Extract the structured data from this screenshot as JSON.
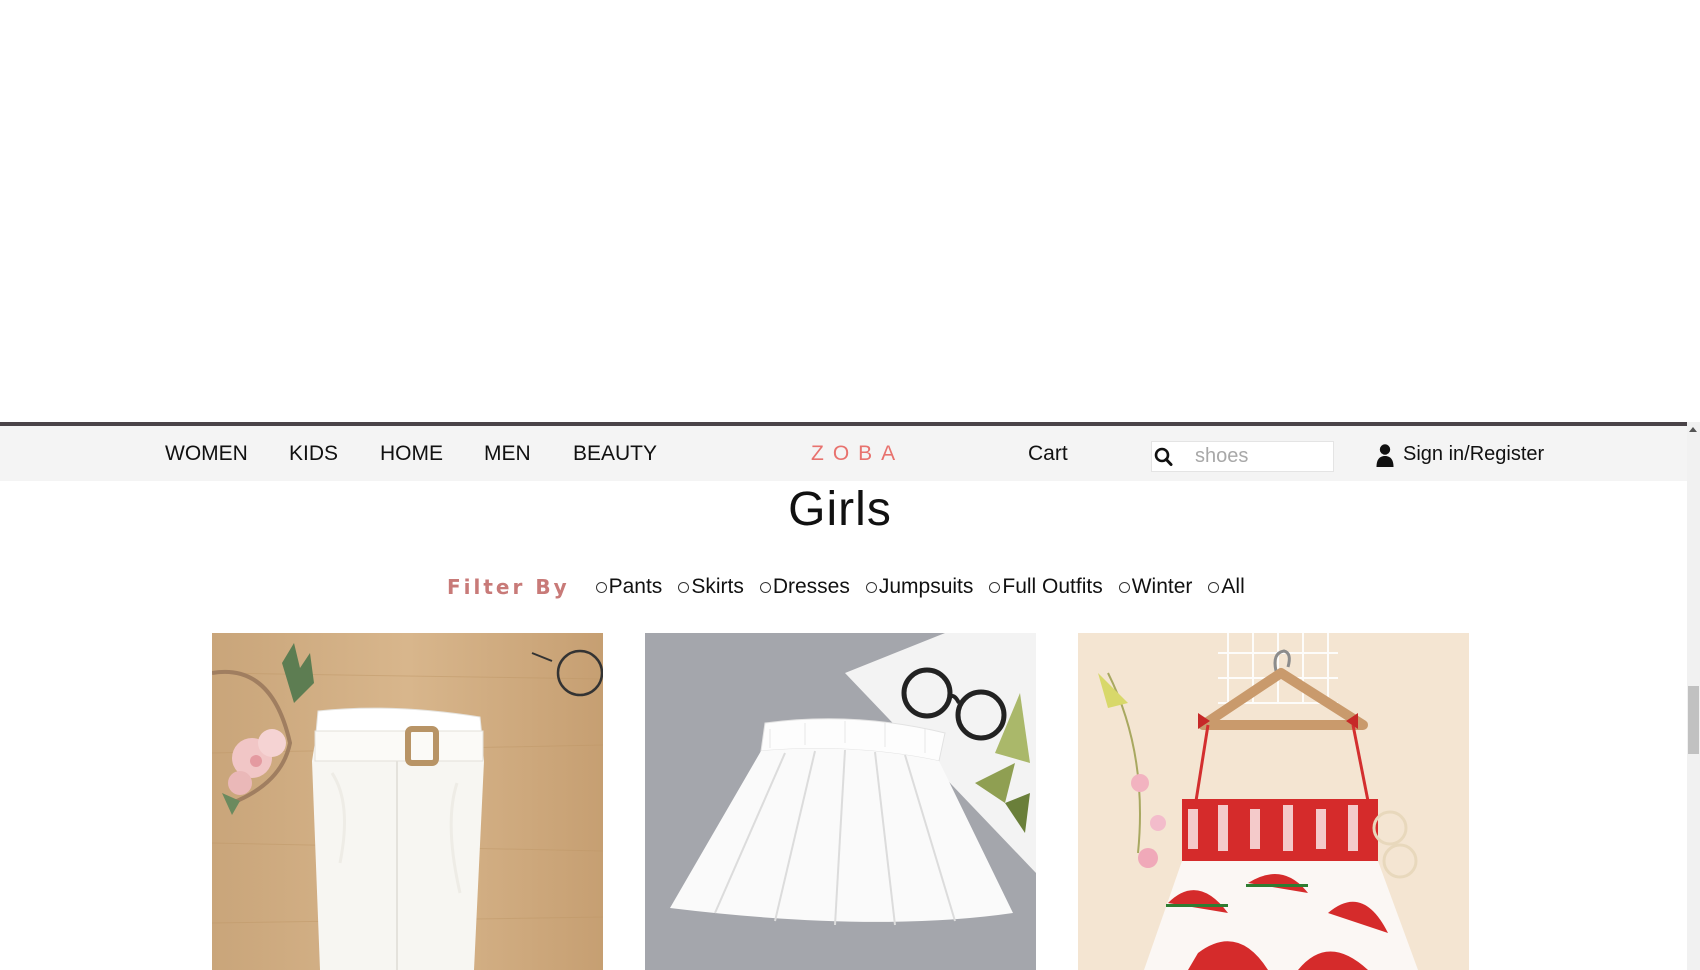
{
  "nav": {
    "links": [
      "WOMEN",
      "KIDS",
      "HOME",
      "MEN",
      "BEAUTY"
    ],
    "brand": "ZOBA",
    "cart_label": "Cart",
    "search": {
      "placeholder": "shoes",
      "value": ""
    },
    "signin_label": "Sign in/Register"
  },
  "page": {
    "title": "Girls"
  },
  "filter": {
    "label": "Filter By",
    "options": [
      "Pants",
      "Skirts",
      "Dresses",
      "Jumpsuits",
      "Full Outfits",
      "Winter",
      "All"
    ]
  },
  "products": [
    {
      "icon": "white-pants-image"
    },
    {
      "icon": "white-skirt-image"
    },
    {
      "icon": "watermelon-dress-image"
    }
  ],
  "colors": {
    "brand": "#e8726e",
    "filter_label": "#c87a78",
    "nav_bg": "#f4f4f4",
    "nav_border": "#4a4448"
  }
}
